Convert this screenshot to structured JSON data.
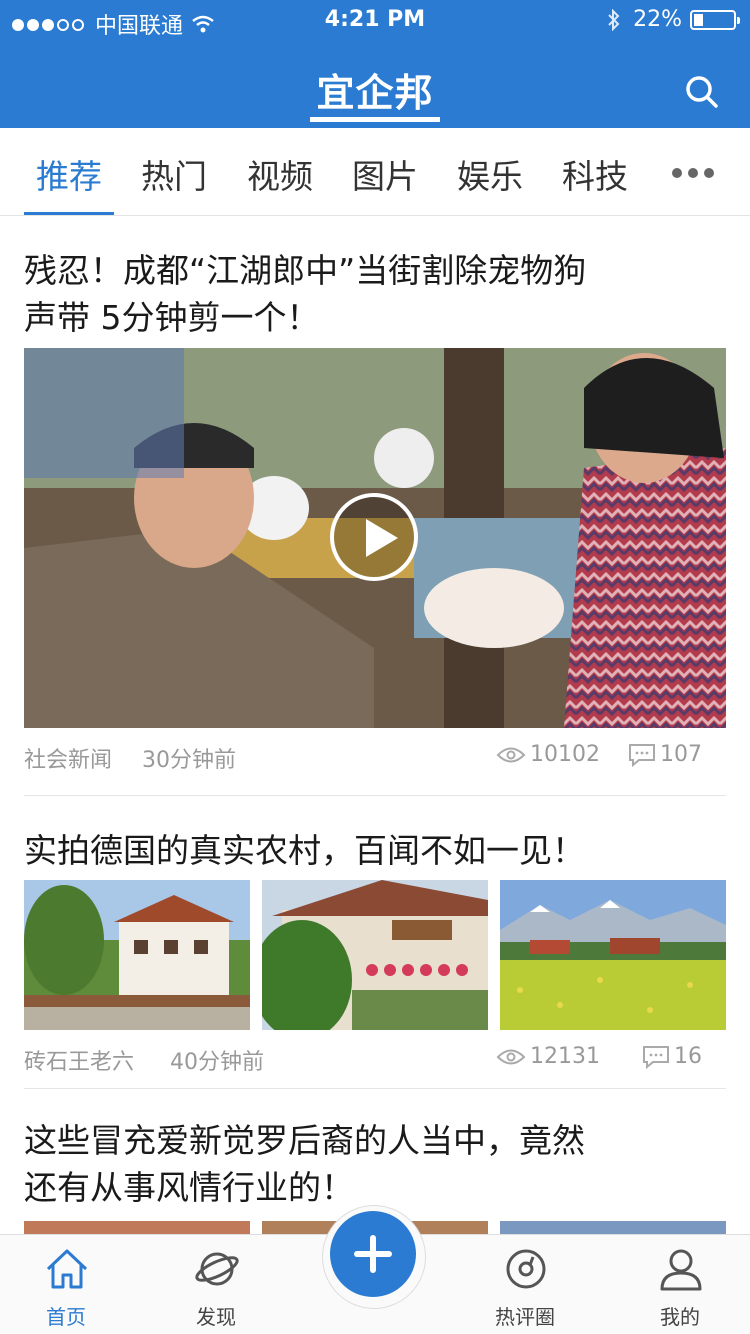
{
  "status_bar": {
    "carrier": "中国联通",
    "time": "4:21 PM",
    "battery": "22%"
  },
  "header": {
    "logo_text": "宜企邦"
  },
  "tabs": [
    {
      "label": "推荐",
      "active": true
    },
    {
      "label": "热门"
    },
    {
      "label": "视频"
    },
    {
      "label": "图片"
    },
    {
      "label": "娱乐"
    },
    {
      "label": "科技"
    }
  ],
  "articles": [
    {
      "title": "残忍！成都“江湖郎中”当街割除宠物狗声带 5分钟剪一个！",
      "title_line1": "残忍！成都“江湖郎中”当街割除宠物狗",
      "title_line2": "声带 5分钟剪一个！",
      "source": "社会新闻",
      "time": "30分钟前",
      "views": "10102",
      "comments": "107",
      "media": "video"
    },
    {
      "title": "实拍德国的真实农村，百闻不如一见！",
      "source": "砖石王老六",
      "time": "40分钟前",
      "views": "12131",
      "comments": "16",
      "media": "three-images"
    },
    {
      "title_line1": "这些冒充爱新觉罗后裔的人当中，竟然",
      "title_line2": "还有从事风情行业的！",
      "media": "three-images"
    }
  ],
  "bottom_nav": [
    {
      "label": "首页",
      "icon": "home-icon",
      "active": true
    },
    {
      "label": "发现",
      "icon": "planet-icon"
    },
    {
      "label": "热评圈",
      "icon": "compass-icon"
    },
    {
      "label": "我的",
      "icon": "user-icon"
    }
  ],
  "colors": {
    "brand": "#2a7bd1",
    "meta_text": "#999999"
  }
}
